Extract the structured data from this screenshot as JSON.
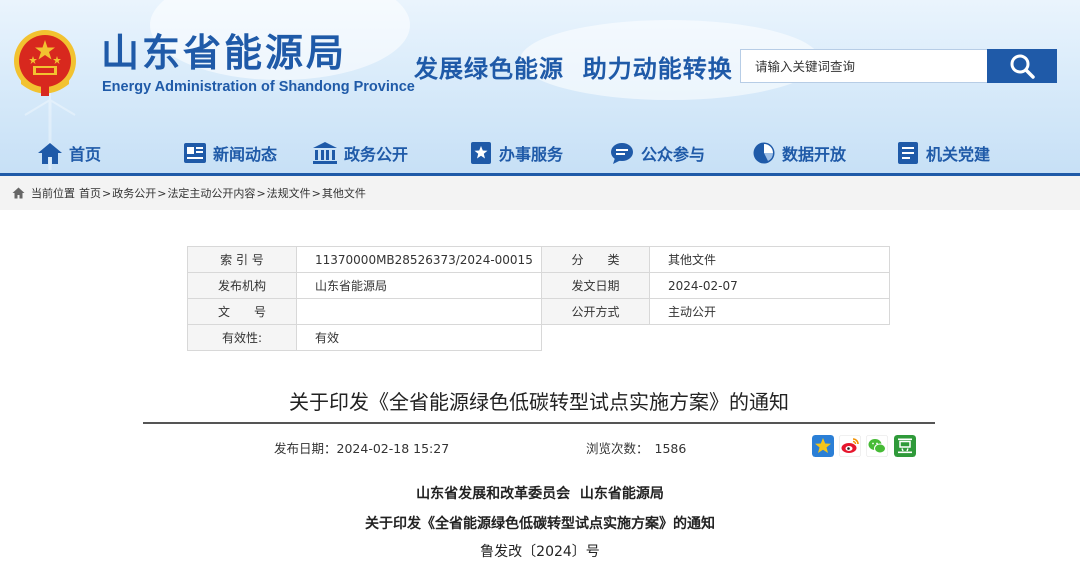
{
  "header": {
    "title": "山东省能源局",
    "subtitle": "Energy Administration of Shandong Province",
    "slogan": "发展绿色能源  助力动能转换",
    "search_placeholder": "请输入关键词查询"
  },
  "nav": {
    "items": [
      {
        "label": "首页",
        "icon": "home-icon"
      },
      {
        "label": "新闻动态",
        "icon": "news-icon"
      },
      {
        "label": "政务公开",
        "icon": "government-building-icon"
      },
      {
        "label": "办事服务",
        "icon": "service-icon"
      },
      {
        "label": "公众参与",
        "icon": "chat-icon"
      },
      {
        "label": "数据开放",
        "icon": "pie-chart-icon"
      },
      {
        "label": "机关党建",
        "icon": "document-icon"
      }
    ]
  },
  "breadcrumb": {
    "prefix": "当前位置",
    "items": [
      "首页",
      "政务公开",
      "法定主动公开内容",
      "法规文件",
      "其他文件"
    ]
  },
  "meta": {
    "index_label": "索 引 号",
    "index_value": "11370000MB28526373/2024-00015",
    "category_label": "分　　类",
    "category_value": "其他文件",
    "issuer_label": "发布机构",
    "issuer_value": "山东省能源局",
    "issue_date_label": "发文日期",
    "issue_date_value": "2024-02-07",
    "doc_no_label": "文　　号",
    "doc_no_value": "",
    "disclosure_label": "公开方式",
    "disclosure_value": "主动公开",
    "validity_label": "有效性:",
    "validity_value": "有效"
  },
  "article": {
    "title": "关于印发《全省能源绿色低碳转型试点实施方案》的通知",
    "pubdate_label": "发布日期：",
    "pubdate": "2024-02-18 15:27",
    "views_label": "浏览次数：",
    "views": "1586",
    "share_icons": [
      "qzone-icon",
      "weibo-icon",
      "wechat-icon",
      "douban-icon"
    ],
    "issuers_line": "山东省发展和改革委员会  山东省能源局",
    "doc_title": "关于印发《全省能源绿色低碳转型试点实施方案》的通知",
    "doc_number": "鲁发改〔2024〕号"
  },
  "colors": {
    "brand_blue": "#1f5aa8",
    "emblem_red": "#d8281e",
    "emblem_gold": "#f2c230"
  }
}
